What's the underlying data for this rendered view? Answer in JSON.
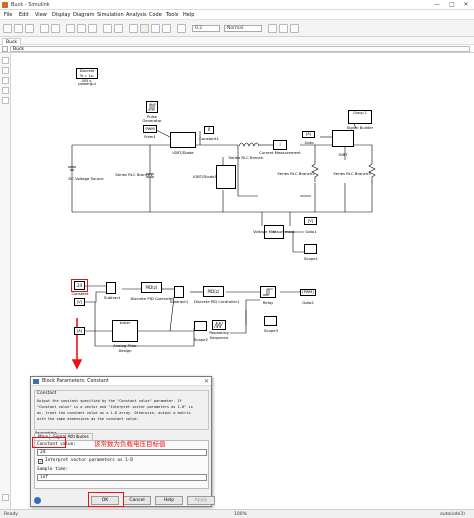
{
  "window": {
    "title": "Buck - Simulink",
    "controls": [
      "—",
      "□",
      "✕"
    ]
  },
  "menu": [
    "File",
    "Edit",
    "View",
    "Display",
    "Diagram",
    "Simulation",
    "Analysis",
    "Code",
    "Tools",
    "Help"
  ],
  "toolbar": {
    "stop_time": "0.2",
    "mode": "Normal"
  },
  "tab": "Buck",
  "address": "Buck",
  "blocks": {
    "powergui_line1": "Discrete",
    "powergui_line2": "Ts = 1e-005 s.",
    "powergui": "powergui",
    "pulse_gen1": "Pulse",
    "pulse_gen2": "Generator",
    "pwm": "PWM",
    "from1": "From1",
    "igbt_diode": "IGBT/Diode",
    "constant1_val": "0",
    "constant1": "Constant1",
    "series_rlc_branch": "Series RLC Branch",
    "current_measurement": "Current Measurement",
    "goto": "Goto",
    "goto_tag": "[A]",
    "igbt": "IGBT",
    "signal_builder": "Signal Builder",
    "group1": "Group 1",
    "dc_source": "DC Voltage Source",
    "series_rlc_branch1": "Series RLC Branch1",
    "igbt_diode1": "IGBT/Diode1",
    "series_rlc_branch2": "Series RLC Branch2",
    "series_rlc_branch3": "Series RLC Branch3",
    "voltage_measurement": "Voltage Measurement",
    "goto1": "Goto1",
    "goto1_tag": "[V]",
    "scope1": "Scope1",
    "constant_val": "24",
    "constant": "Constant",
    "from_tag": "[V]",
    "subtract": "Subtract",
    "pid": "PID(z)",
    "discrete_pid": "Discrete PID Controller",
    "subtract1": "Subtract1",
    "discrete_pid1": "Discrete PID Controller1",
    "relay": "Relay",
    "goto2": "Goto2",
    "goto2_tag": "[PWM]",
    "from_a_tag": "[A]",
    "analog_filter": "Analog Filter Design",
    "butter": "butter",
    "scope2": "Scope2",
    "repeating_seq": "Repeating Sequence",
    "scope3": "Scope3"
  },
  "dialog": {
    "title": "Block Parameters: Constant",
    "group": "Constant",
    "description": [
      "Output the constant specified by the \"Constant value\" parameter. If",
      "\"Constant value\" is a vector and \"Interpret vector parameters as 1-D\" is",
      "on, treat the constant value as a 1-D array. Otherwise, output a matrix",
      "with the same dimensions as the constant value."
    ],
    "tabs": [
      "Main",
      "Signal Attributes"
    ],
    "active_tab": "Main",
    "constant_value_label": "Constant value:",
    "constant_value": "24",
    "interpret_label": "Interpret vector parameters as 1-D",
    "interpret_checked": true,
    "sample_time_label": "Sample time:",
    "sample_time": "inf",
    "buttons": [
      "OK",
      "Cancel",
      "Help",
      "Apply"
    ]
  },
  "annotation": "该常数为负载电压目标值",
  "status": {
    "left": "Ready",
    "zoom": "100%",
    "solver": "auto(ode3)"
  }
}
